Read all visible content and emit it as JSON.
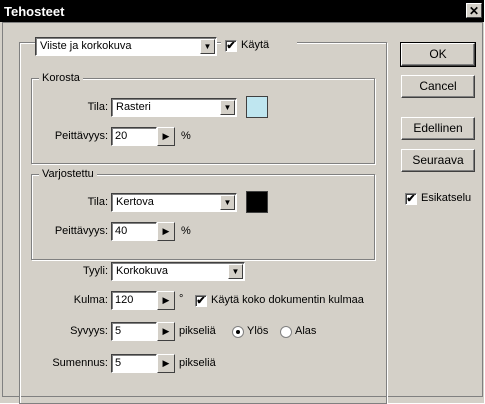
{
  "window": {
    "title": "Tehosteet",
    "close_label": "✕"
  },
  "effect": {
    "selected": "Viiste ja korkokuva",
    "enable_label": "Käytä",
    "enable_checked": true
  },
  "highlight": {
    "legend": "Korosta",
    "mode_label": "Tila:",
    "mode_value": "Rasteri",
    "opacity_label": "Peittävyys:",
    "opacity_value": "20",
    "opacity_unit": "%",
    "color": "#bfe6f0"
  },
  "shadow": {
    "legend": "Varjostettu",
    "mode_label": "Tila:",
    "mode_value": "Kertova",
    "opacity_label": "Peittävyys:",
    "opacity_value": "40",
    "opacity_unit": "%",
    "color": "#000000"
  },
  "style": {
    "label": "Tyyli:",
    "value": "Korkokuva"
  },
  "angle": {
    "label": "Kulma:",
    "value": "120",
    "unit": "°",
    "global_label": "Käytä koko dokumentin kulmaa",
    "global_checked": true
  },
  "depth": {
    "label": "Syvyys:",
    "value": "5",
    "unit": "pikseliä",
    "up_label": "Ylös",
    "down_label": "Alas",
    "direction": "up"
  },
  "blur": {
    "label": "Sumennus:",
    "value": "5",
    "unit": "pikseliä"
  },
  "buttons": {
    "ok": "OK",
    "cancel": "Cancel",
    "previous": "Edellinen",
    "next": "Seuraava"
  },
  "preview": {
    "label": "Esikatselu",
    "checked": true
  },
  "glyphs": {
    "check": "✔",
    "dropdown": "▼",
    "stepper": "▶"
  }
}
